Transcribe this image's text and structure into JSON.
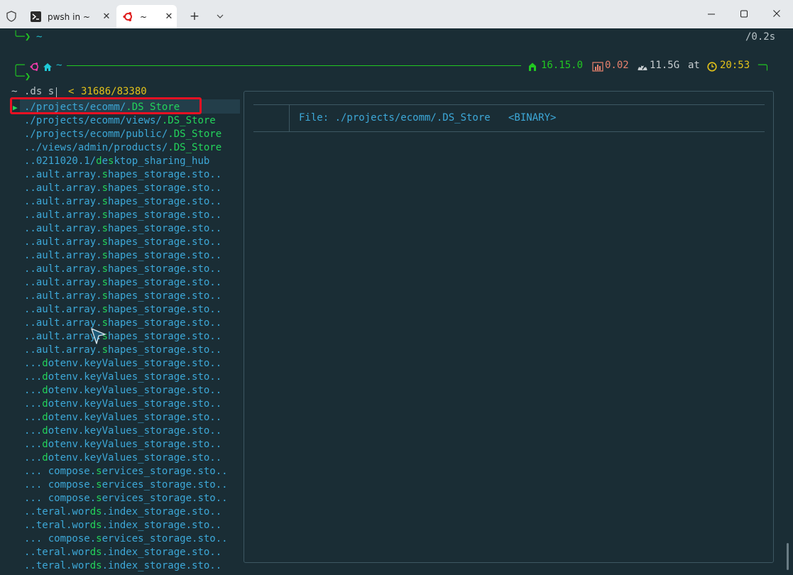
{
  "tabs": [
    {
      "label": "pwsh in ~",
      "close": "✕"
    },
    {
      "label": "~",
      "close": "✕"
    }
  ],
  "window": {
    "new_tab": "+"
  },
  "prompt_prev": {
    "arrow": "╰─❯",
    "path": "~",
    "duration": "/0.2s"
  },
  "prompt": {
    "corner_top": "╭─",
    "path": "~",
    "node_version": "16.15.0",
    "load": "0.02",
    "memory": "11.5G",
    "at": "at",
    "time": "20:53",
    "corner_right": "─╮",
    "arrow": "╰─❯"
  },
  "search": {
    "prefix": "~",
    "query": ".ds s",
    "separator": "<",
    "counts": "31686/83380"
  },
  "file_list": [
    {
      "pre": "./projects/ecomm/",
      "m": ".DS_Store",
      "post": ""
    },
    {
      "pre": "./projects/ecomm/views/",
      "m": ".DS_Store",
      "post": ""
    },
    {
      "pre": "./projects/ecomm/public/",
      "m": ".DS_Store",
      "post": ""
    },
    {
      "pre": "../views/admin/products/",
      "m": ".DS_Store",
      "post": ""
    },
    {
      "pre": "..0211020.1/",
      "m": "d",
      "post": "e",
      "m2": "s",
      "post2": "ktop_sharing_hub"
    },
    {
      "pre": "..ault.array.",
      "m": "s",
      "post": "hapes_storage.sto.."
    },
    {
      "pre": "..ault.array.",
      "m": "s",
      "post": "hapes_storage.sto.."
    },
    {
      "pre": "..ault.array.",
      "m": "s",
      "post": "hapes_storage.sto.."
    },
    {
      "pre": "..ault.array.",
      "m": "s",
      "post": "hapes_storage.sto.."
    },
    {
      "pre": "..ault.array.",
      "m": "s",
      "post": "hapes_storage.sto.."
    },
    {
      "pre": "..ault.array.",
      "m": "s",
      "post": "hapes_storage.sto.."
    },
    {
      "pre": "..ault.array.",
      "m": "s",
      "post": "hapes_storage.sto.."
    },
    {
      "pre": "..ault.array.",
      "m": "s",
      "post": "hapes_storage.sto.."
    },
    {
      "pre": "..ault.array.",
      "m": "s",
      "post": "hapes_storage.sto.."
    },
    {
      "pre": "..ault.array.",
      "m": "s",
      "post": "hapes_storage.sto.."
    },
    {
      "pre": "..ault.array.",
      "m": "s",
      "post": "hapes_storage.sto.."
    },
    {
      "pre": "..ault.array.",
      "m": "s",
      "post": "hapes_storage.sto.."
    },
    {
      "pre": "..ault.array.",
      "m": "s",
      "post": "hapes_storage.sto.."
    },
    {
      "pre": "..ault.array.",
      "m": "s",
      "post": "hapes_storage.sto.."
    },
    {
      "pre": "...",
      "m": "d",
      "post": "otenv.keyValues_storage.sto.."
    },
    {
      "pre": "...",
      "m": "d",
      "post": "otenv.keyValues_storage.sto.."
    },
    {
      "pre": "...",
      "m": "d",
      "post": "otenv.keyValues_storage.sto.."
    },
    {
      "pre": "...",
      "m": "d",
      "post": "otenv.keyValues_storage.sto.."
    },
    {
      "pre": "...",
      "m": "d",
      "post": "otenv.keyValues_storage.sto.."
    },
    {
      "pre": "...",
      "m": "d",
      "post": "otenv.keyValues_storage.sto.."
    },
    {
      "pre": "...",
      "m": "d",
      "post": "otenv.keyValues_storage.sto.."
    },
    {
      "pre": "...",
      "m": "d",
      "post": "otenv.keyValues_storage.sto.."
    },
    {
      "pre": "... compose.",
      "m": "s",
      "post": "ervices_storage.sto.."
    },
    {
      "pre": "... compose.",
      "m": "s",
      "post": "ervices_storage.sto.."
    },
    {
      "pre": "... compose.",
      "m": "s",
      "post": "ervices_storage.sto.."
    },
    {
      "pre": "..teral.wor",
      "m": "ds",
      "post": ".index_storage.sto.."
    },
    {
      "pre": "..teral.wor",
      "m": "ds",
      "post": ".index_storage.sto.."
    },
    {
      "pre": "... compose.",
      "m": "s",
      "post": "ervices_storage.sto.."
    },
    {
      "pre": "..teral.wor",
      "m": "ds",
      "post": ".index_storage.sto.."
    },
    {
      "pre": "..teral.wor",
      "m": "ds",
      "post": ".index_storage.sto.."
    }
  ],
  "selected_marker": "▶",
  "preview": {
    "file_label": "File: ./projects/ecomm/.DS_Store   <BINARY>"
  },
  "colors": {
    "background": "#1a2d35",
    "match": "#23d45b",
    "path": "#3da8d8",
    "highlight_box": "#e81123"
  }
}
